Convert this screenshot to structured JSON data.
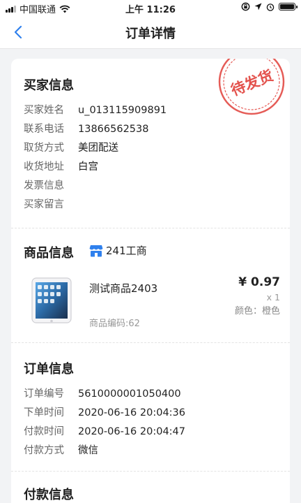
{
  "status_bar": {
    "carrier": "中国联通",
    "time": "上午 11:26"
  },
  "nav": {
    "title": "订单详情"
  },
  "buyer": {
    "title": "买家信息",
    "stamp_text": "待发货",
    "fields": [
      {
        "label": "买家姓名",
        "value": "u_013115909891"
      },
      {
        "label": "联系电话",
        "value": "13866562538"
      },
      {
        "label": "取货方式",
        "value": "美团配送"
      },
      {
        "label": "收货地址",
        "value": "白宫"
      },
      {
        "label": "发票信息",
        "value": ""
      },
      {
        "label": "买家留言",
        "value": ""
      }
    ]
  },
  "goods": {
    "title": "商品信息",
    "shop_name": "241工商",
    "product": {
      "name": "测试商品2403",
      "price": "¥ 0.97",
      "qty": "x 1",
      "attr": "颜色：橙色",
      "code": "商品编码:62"
    }
  },
  "order": {
    "title": "订单信息",
    "fields": [
      {
        "label": "订单编号",
        "value": "5610000001050400"
      },
      {
        "label": "下单时间",
        "value": "2020-06-16 20:04:36"
      },
      {
        "label": "付款时间",
        "value": "2020-06-16 20:04:47"
      },
      {
        "label": "付款方式",
        "value": "微信"
      }
    ]
  },
  "payment": {
    "title": "付款信息"
  },
  "colors": {
    "accent": "#2f80ed",
    "stamp": "#e0403a"
  }
}
